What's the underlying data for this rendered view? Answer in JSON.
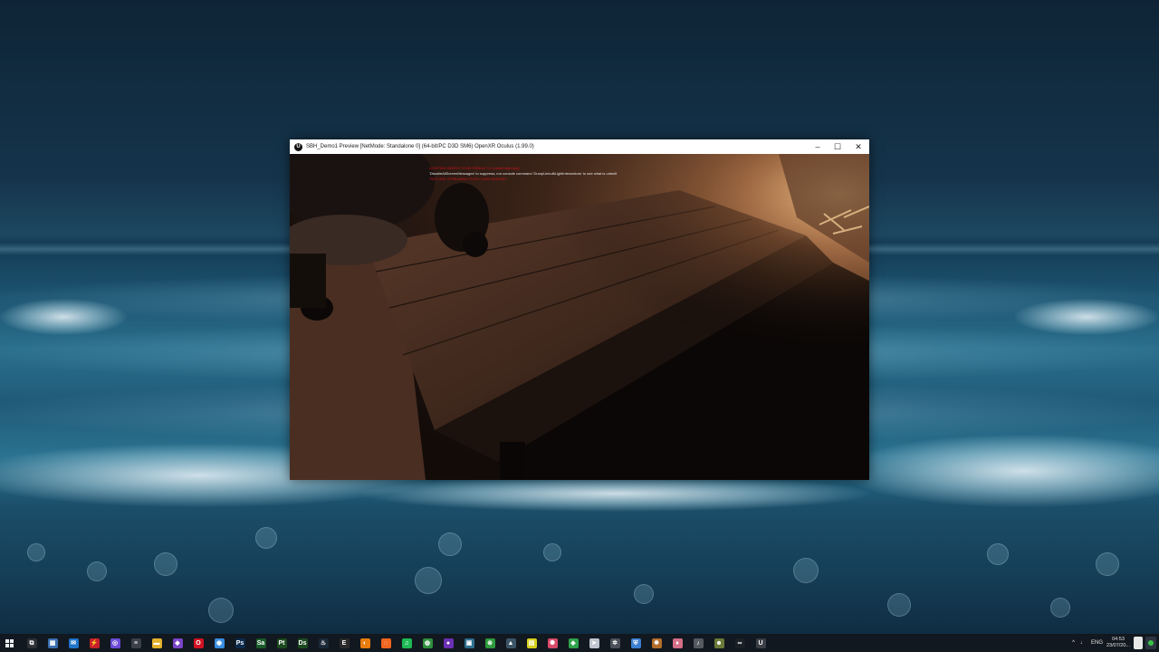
{
  "window": {
    "title": "SBH_Demo1 Preview [NetMode: Standalone 0]  (64-bit/PC D3D SM6) OpenXR Oculus (1.99.0)",
    "minimize_glyph": "–",
    "maximize_glyph": "☐",
    "close_glyph": "✕"
  },
  "console": {
    "line_error_1": "LIGHTING NEEDS TO BE REBUILT (1 unbuilt object(s))",
    "line_info": "'DisableAllScreenMessages' to suppress; run console command 'DumpUnbuiltLightInteractions' to see what is unbuilt",
    "line_error_2": "TEXTURE STREAMING POOL OVER BUDGET"
  },
  "colors": {
    "console_error": "#d0121b",
    "console_info": "#e6e6e6",
    "taskbar_bg": "#12181f"
  },
  "taskbar": {
    "icons": [
      {
        "name": "task-view-icon",
        "glyph": "⧉",
        "color": "#2b2f36"
      },
      {
        "name": "calculator-icon",
        "glyph": "▦",
        "color": "#3a6fb0"
      },
      {
        "name": "mail-icon",
        "glyph": "✉",
        "color": "#1f74c9"
      },
      {
        "name": "flash-app-icon",
        "glyph": "⚡",
        "color": "#c8202a"
      },
      {
        "name": "discord-icon",
        "glyph": "◎",
        "color": "#6c4bd8"
      },
      {
        "name": "mixer-settings-icon",
        "glyph": "≡",
        "color": "#3b4048"
      },
      {
        "name": "file-explorer-icon",
        "glyph": "▬",
        "color": "#e2b22d"
      },
      {
        "name": "visual-studio-icon",
        "glyph": "◆",
        "color": "#7a45c7"
      },
      {
        "name": "opera-icon",
        "glyph": "O",
        "color": "#d21324"
      },
      {
        "name": "chrome-icon",
        "glyph": "◉",
        "color": "#3a8ee0"
      },
      {
        "name": "photoshop-icon",
        "glyph": "Ps",
        "color": "#0c2b4d"
      },
      {
        "name": "substance-sampler-icon",
        "glyph": "Sa",
        "color": "#1a5a2a"
      },
      {
        "name": "substance-painter-icon",
        "glyph": "Pt",
        "color": "#1b4a1e"
      },
      {
        "name": "substance-designer-icon",
        "glyph": "Ds",
        "color": "#1c4a20"
      },
      {
        "name": "steam-icon",
        "glyph": "♨",
        "color": "#1b2838"
      },
      {
        "name": "epic-games-icon",
        "glyph": "E",
        "color": "#2a2a2a"
      },
      {
        "name": "blender-icon",
        "glyph": "◐",
        "color": "#e87d0d"
      },
      {
        "name": "origin-icon",
        "glyph": "◌",
        "color": "#f0651f"
      },
      {
        "name": "spotify-icon",
        "glyph": "♫",
        "color": "#1db954"
      },
      {
        "name": "greenshot-icon",
        "glyph": "◍",
        "color": "#2f8f3f"
      },
      {
        "name": "obs-icon",
        "glyph": "●",
        "color": "#6b2fb4"
      },
      {
        "name": "remote-desktop-icon",
        "glyph": "▣",
        "color": "#2f6f8f"
      },
      {
        "name": "xbox-icon",
        "glyph": "⊗",
        "color": "#2e9a3c"
      },
      {
        "name": "launcher-icon",
        "glyph": "▲",
        "color": "#3b5566"
      },
      {
        "name": "notes-icon",
        "glyph": "▤",
        "color": "#d6d11f"
      },
      {
        "name": "color-wheel-icon",
        "glyph": "✺",
        "color": "#d84a6a"
      },
      {
        "name": "maps-icon",
        "glyph": "◈",
        "color": "#2ea24a"
      },
      {
        "name": "cursor-tool-icon",
        "glyph": "➤",
        "color": "#c0c6cf"
      },
      {
        "name": "settings-gear-icon",
        "glyph": "✲",
        "color": "#4a5058"
      },
      {
        "name": "shield-icon",
        "glyph": "⛨",
        "color": "#3a7fd2"
      },
      {
        "name": "game-app-icon",
        "glyph": "✹",
        "color": "#b26d2a"
      },
      {
        "name": "droplet-app-icon",
        "glyph": "♦",
        "color": "#d56e87"
      },
      {
        "name": "music-app-icon",
        "glyph": "♪",
        "color": "#555a62"
      },
      {
        "name": "character-app-icon",
        "glyph": "☻",
        "color": "#6a7a38"
      },
      {
        "name": "meta-quest-icon",
        "glyph": "∞",
        "color": "#1a1f26"
      },
      {
        "name": "unreal-engine-icon",
        "glyph": "U",
        "color": "#3a3f46"
      }
    ],
    "tray": {
      "chevron_glyph": "^",
      "mic_glyph": "♩",
      "language": "ENG",
      "time": "04:53",
      "date": "23/07/20..."
    }
  }
}
